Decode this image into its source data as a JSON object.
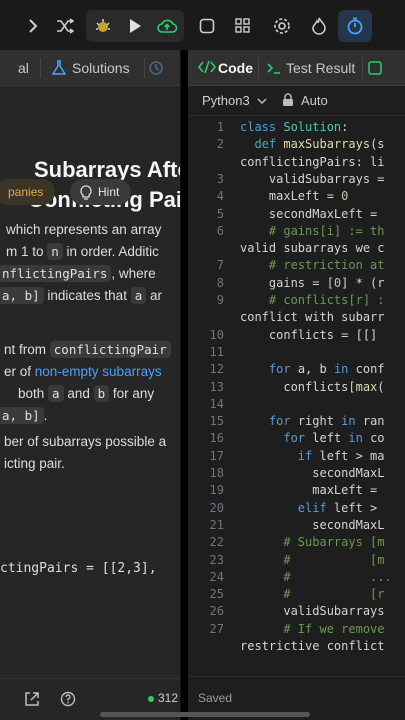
{
  "toolbar": {
    "icons": [
      "chevron-right-icon",
      "shuffle-icon",
      "debug-icon",
      "play-icon",
      "upload-cloud-icon",
      "note-icon",
      "layout-icon",
      "settings-icon",
      "flame-icon",
      "timer-icon"
    ],
    "colors": {
      "cloud": "#2ecc71",
      "timer_bg": "#23364a",
      "timer": "#4d9fff"
    }
  },
  "left": {
    "tabs": {
      "partial": "al",
      "solutions": "Solutions"
    },
    "title_line1": "Subarrays Afte",
    "title_line2": "Conflicting Pair",
    "chips": {
      "companies": "panies",
      "hint": "Hint"
    },
    "desc": {
      "l1": "which represents an array",
      "l2a": "m 1 to ",
      "l2n": "n",
      "l2b": " in order. Additic",
      "l3a": "nflictingPairs",
      "l3b": ", where",
      "l4a": "a, b]",
      "l4b": " indicates that ",
      "l4c": "a",
      "l4d": " ar",
      "l5a": "nt from ",
      "l5b": "conflictingPair",
      "l6a": "er of ",
      "l6b": "non-empty subarrays",
      "l7a": " both ",
      "l7b": "a",
      "l7c": " and ",
      "l7d": "b",
      "l7e": " for any",
      "l8a": "a, b]",
      "l8b": ".",
      "l9": "ber of subarrays possible a",
      "l10": "icting pair."
    },
    "example": "ctingPairs = [[2,3],",
    "bottom": {
      "count": "312"
    }
  },
  "right": {
    "tabs": {
      "code": "Code",
      "test_result": "Test Result"
    },
    "language": "Python3",
    "mode": "Auto",
    "status": "Saved",
    "lines": [
      {
        "n": "1",
        "t": "class Solution:"
      },
      {
        "n": "2",
        "t": "  def maxSubarrays(s"
      },
      {
        "n": "",
        "t": "conflictingPairs: li"
      },
      {
        "n": "3",
        "t": "    validSubarrays ="
      },
      {
        "n": "4",
        "t": "    maxLeft = 0"
      },
      {
        "n": "5",
        "t": "    secondMaxLeft ="
      },
      {
        "n": "6",
        "t": "    # gains[i] := th"
      },
      {
        "n": "",
        "t": "valid subarrays we c"
      },
      {
        "n": "7",
        "t": "    # restriction at"
      },
      {
        "n": "8",
        "t": "    gains = [0] * (r"
      },
      {
        "n": "9",
        "t": "    # conflicts[r] :"
      },
      {
        "n": "",
        "t": "conflict with subarr"
      },
      {
        "n": "10",
        "t": "    conflicts = [[]"
      },
      {
        "n": "11",
        "t": ""
      },
      {
        "n": "12",
        "t": "    for a, b in conf"
      },
      {
        "n": "13",
        "t": "      conflicts[max("
      },
      {
        "n": "14",
        "t": ""
      },
      {
        "n": "15",
        "t": "    for right in ran"
      },
      {
        "n": "16",
        "t": "      for left in co"
      },
      {
        "n": "17",
        "t": "        if left > ma"
      },
      {
        "n": "18",
        "t": "          secondMaxL"
      },
      {
        "n": "19",
        "t": "          maxLeft ="
      },
      {
        "n": "20",
        "t": "        elif left >"
      },
      {
        "n": "21",
        "t": "          secondMaxL"
      },
      {
        "n": "22",
        "t": "      # Subarrays [m"
      },
      {
        "n": "23",
        "t": "      #           [m"
      },
      {
        "n": "24",
        "t": "      #           ..."
      },
      {
        "n": "25",
        "t": "      #           [r"
      },
      {
        "n": "26",
        "t": "      validSubarrays"
      },
      {
        "n": "27",
        "t": "      # If we remove"
      },
      {
        "n": "",
        "t": "restrictive conflict"
      }
    ]
  }
}
